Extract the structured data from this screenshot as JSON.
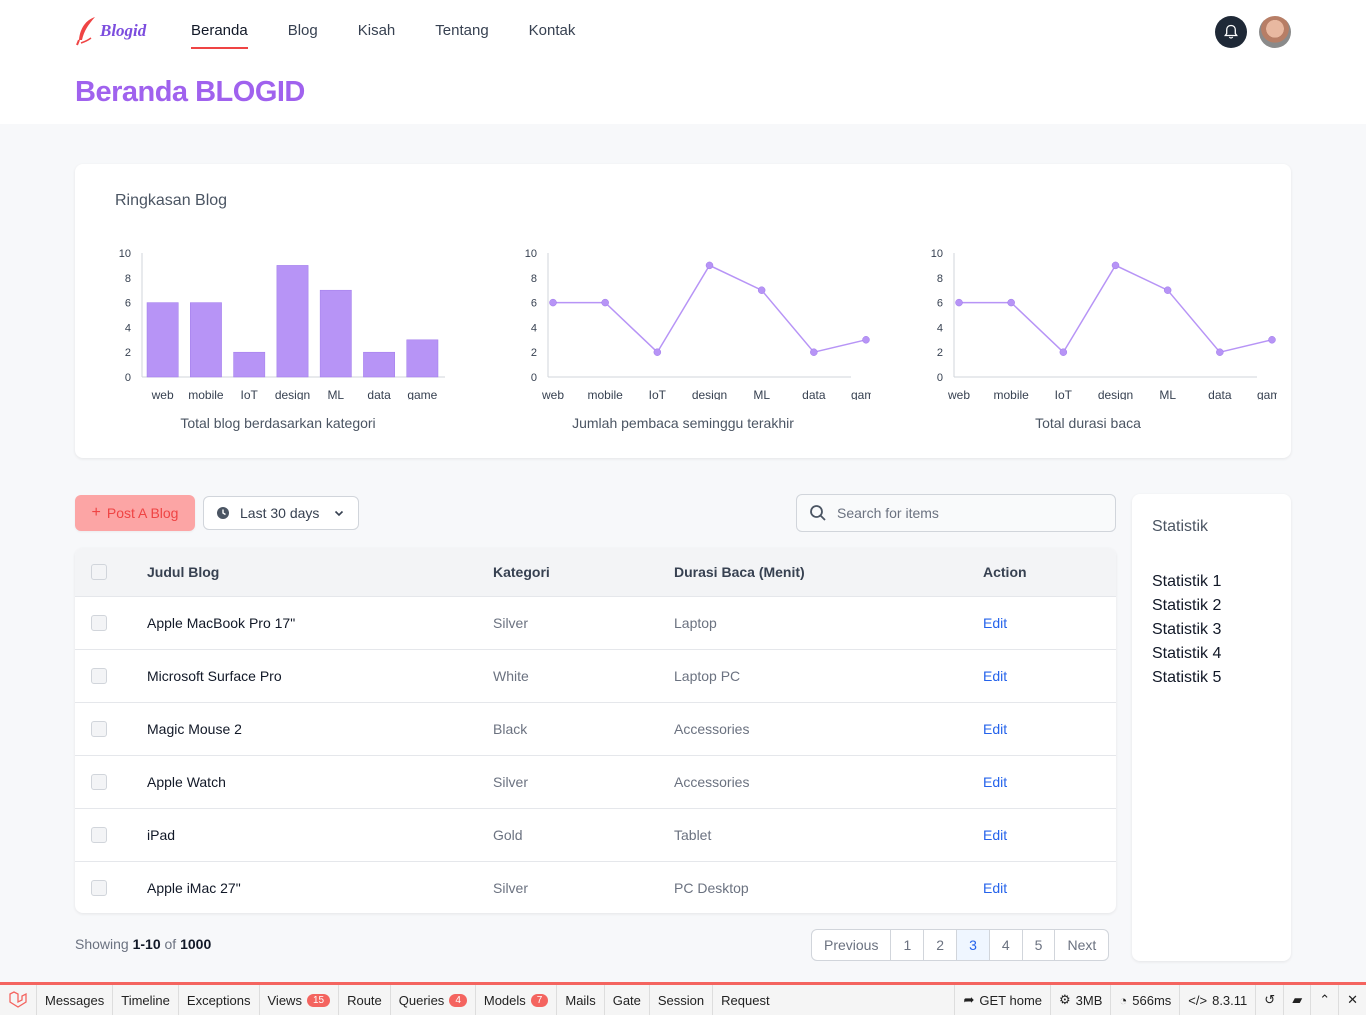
{
  "brand": {
    "name": "Blogid",
    "color": "#7c4dde",
    "accent": "#ef4444"
  },
  "nav": {
    "items": [
      "Beranda",
      "Blog",
      "Kisah",
      "Tentang",
      "Kontak"
    ],
    "active": "Beranda"
  },
  "page": {
    "title": "Beranda BLOGID"
  },
  "summary": {
    "title": "Ringkasan Blog",
    "charts": [
      {
        "caption": "Total blog berdasarkan kategori"
      },
      {
        "caption": "Jumlah pembaca seminggu terakhir"
      },
      {
        "caption": "Total durasi baca"
      }
    ]
  },
  "chart_data": [
    {
      "type": "bar",
      "categories": [
        "web",
        "mobile",
        "IoT",
        "design",
        "ML",
        "data",
        "game"
      ],
      "values": [
        6,
        6,
        2,
        9,
        7,
        2,
        3
      ],
      "ylim": [
        0,
        10
      ],
      "yticks": [
        0,
        2,
        4,
        6,
        8,
        10
      ],
      "xlabel": "Total blog berdasarkan kategori",
      "ylabel": "",
      "color": "#b794f6"
    },
    {
      "type": "line",
      "categories": [
        "web",
        "mobile",
        "IoT",
        "design",
        "ML",
        "data",
        "game"
      ],
      "values": [
        6,
        6,
        2,
        9,
        7,
        2,
        3
      ],
      "ylim": [
        0,
        10
      ],
      "yticks": [
        0,
        2,
        4,
        6,
        8,
        10
      ],
      "xlabel": "Jumlah pembaca seminggu terakhir",
      "ylabel": "",
      "color": "#b794f6"
    },
    {
      "type": "line",
      "categories": [
        "web",
        "mobile",
        "IoT",
        "design",
        "ML",
        "data",
        "game"
      ],
      "values": [
        6,
        6,
        2,
        9,
        7,
        2,
        3
      ],
      "ylim": [
        0,
        10
      ],
      "yticks": [
        0,
        2,
        4,
        6,
        8,
        10
      ],
      "xlabel": "Total durasi baca",
      "ylabel": "",
      "color": "#b794f6"
    }
  ],
  "toolbar": {
    "post_label": "Post A Blog",
    "date_label": "Last 30 days",
    "search_placeholder": "Search for items"
  },
  "table": {
    "headers": {
      "title": "Judul Blog",
      "category": "Kategori",
      "duration": "Durasi Baca (Menit)",
      "action": "Action"
    },
    "rows": [
      {
        "title": "Apple MacBook Pro 17\"",
        "category": "Silver",
        "duration": "Laptop",
        "action": "Edit"
      },
      {
        "title": "Microsoft Surface Pro",
        "category": "White",
        "duration": "Laptop PC",
        "action": "Edit"
      },
      {
        "title": "Magic Mouse 2",
        "category": "Black",
        "duration": "Accessories",
        "action": "Edit"
      },
      {
        "title": "Apple Watch",
        "category": "Silver",
        "duration": "Accessories",
        "action": "Edit"
      },
      {
        "title": "iPad",
        "category": "Gold",
        "duration": "Tablet",
        "action": "Edit"
      },
      {
        "title": "Apple iMac 27\"",
        "category": "Silver",
        "duration": "PC Desktop",
        "action": "Edit"
      }
    ]
  },
  "pagination": {
    "showing_prefix": "Showing",
    "range": "1-10",
    "of": "of",
    "total": "1000",
    "previous": "Previous",
    "next": "Next",
    "pages": [
      "1",
      "2",
      "3",
      "4",
      "5"
    ],
    "current": "3"
  },
  "stats": {
    "title": "Statistik",
    "items": [
      "Statistik 1",
      "Statistik 2",
      "Statistik 3",
      "Statistik 4",
      "Statistik 5"
    ]
  },
  "debugbar": {
    "tabs": [
      {
        "label": "Messages"
      },
      {
        "label": "Timeline"
      },
      {
        "label": "Exceptions"
      },
      {
        "label": "Views",
        "badge": "15"
      },
      {
        "label": "Route"
      },
      {
        "label": "Queries",
        "badge": "4"
      },
      {
        "label": "Models",
        "badge": "7"
      },
      {
        "label": "Mails"
      },
      {
        "label": "Gate"
      },
      {
        "label": "Session"
      },
      {
        "label": "Request"
      }
    ],
    "route": "GET home",
    "memory": "3MB",
    "time": "566ms",
    "version": "8.3.11"
  }
}
